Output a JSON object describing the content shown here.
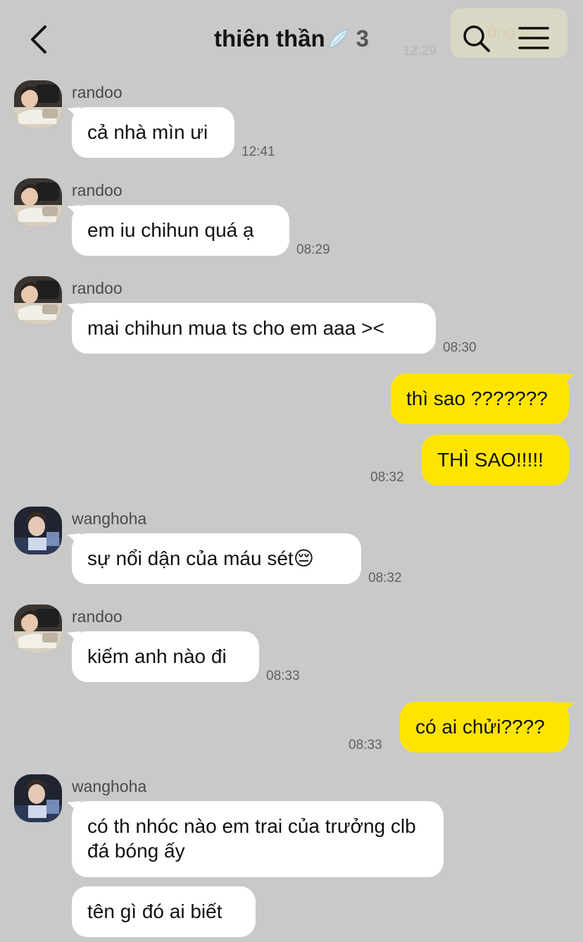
{
  "header": {
    "title": "thiên thần",
    "member_count": "3",
    "ghost_time": "12:29",
    "ghost_pill_text": "ông ớ"
  },
  "colors": {
    "background": "#c9c9c9",
    "incoming_bubble": "#ffffff",
    "outgoing_bubble": "#fee500"
  },
  "messages": [
    {
      "sender": "randoo",
      "text": "cả nhà mìn ưi",
      "time": "12:41",
      "direction": "in"
    },
    {
      "sender": "randoo",
      "text": "em iu chihun quá ạ",
      "time": "08:29",
      "direction": "in"
    },
    {
      "sender": "randoo",
      "text": "mai chihun mua ts cho em aaa ><",
      "time": "08:30",
      "direction": "in"
    },
    {
      "text": "thì sao ???????",
      "direction": "out"
    },
    {
      "text": "THÌ SAO!!!!!",
      "time": "08:32",
      "direction": "out"
    },
    {
      "sender": "wanghoha",
      "text": "sự nổi dận của máu sét😔",
      "time": "08:32",
      "direction": "in"
    },
    {
      "sender": "randoo",
      "text": "kiếm anh nào đi",
      "time": "08:33",
      "direction": "in"
    },
    {
      "text": "có ai chửi????",
      "time": "08:33",
      "direction": "out"
    },
    {
      "sender": "wanghoha",
      "text": "có th nhóc nào em trai của trưởng clb đá bóng ấy",
      "direction": "in"
    },
    {
      "text": "tên gì đó ai biết",
      "direction": "in"
    }
  ]
}
